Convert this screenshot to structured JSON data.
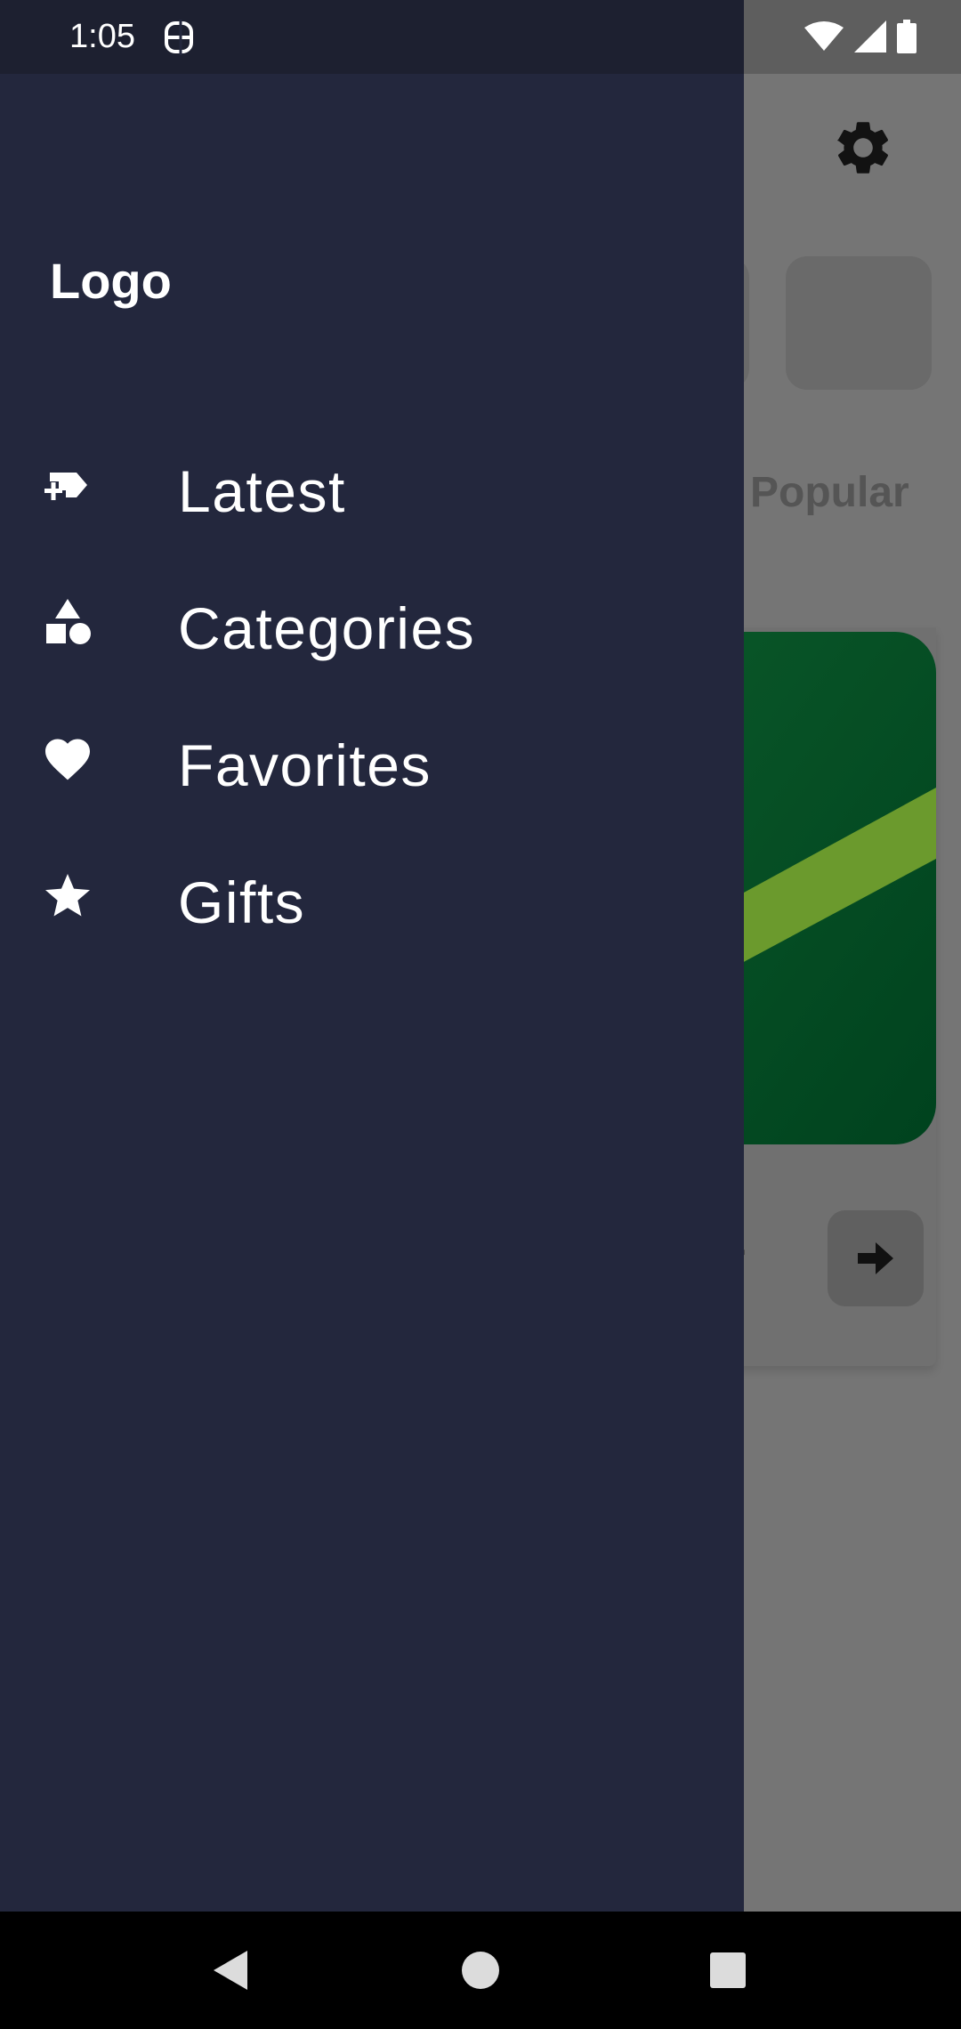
{
  "status_bar": {
    "time": "1:05",
    "icons": [
      "s-notification-icon",
      "wifi-icon",
      "cell-signal-icon",
      "battery-icon"
    ]
  },
  "background": {
    "settings_icon": "gear-icon",
    "tab_label": "Popular",
    "card_title_fragment": "er",
    "card_button_icon": "arrow-right-icon",
    "card_image_colors": [
      "#0b5a2a",
      "#00421e",
      "#6b9a2d"
    ]
  },
  "drawer": {
    "logo": "Logo",
    "items": [
      {
        "label": "Latest",
        "icon": "new-label-icon"
      },
      {
        "label": "Categories",
        "icon": "shapes-icon"
      },
      {
        "label": "Favorites",
        "icon": "heart-icon"
      },
      {
        "label": "Gifts",
        "icon": "star-icon"
      }
    ],
    "background_color": "#23273d"
  },
  "system_nav": {
    "buttons": [
      "back-icon",
      "home-icon",
      "recents-icon"
    ]
  }
}
